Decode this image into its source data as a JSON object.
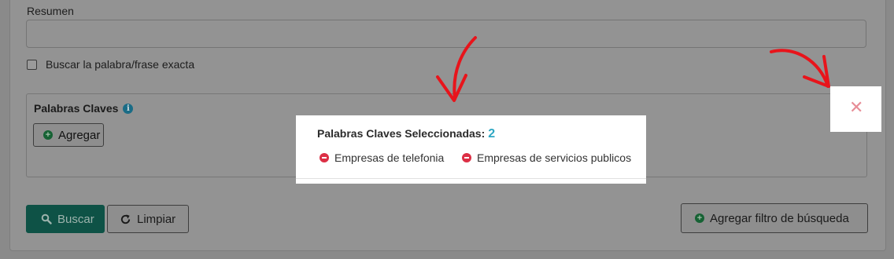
{
  "form": {
    "resumen_label": "Resumen",
    "resumen_value": "",
    "exact_label": "Buscar la palabra/frase exacta",
    "keywords_title": "Palabras Claves",
    "add_label": "Agregar",
    "search_label": "Buscar",
    "clear_label": "Limpiar",
    "add_filter_label": "Agregar filtro de búsqueda"
  },
  "popup": {
    "title": "Palabras Claves Seleccionadas:",
    "count": "2",
    "items": [
      {
        "label": "Empresas de telefonia"
      },
      {
        "label": "Empresas de servicios publicos"
      }
    ]
  },
  "close": {
    "symbol": "✕"
  },
  "icons": {
    "info": "info-icon",
    "plus": "plus-circle-icon",
    "minus": "minus-circle-icon",
    "search": "search-icon",
    "refresh": "refresh-icon",
    "close": "close-icon"
  },
  "colors": {
    "primary": "#0e5246",
    "count": "#2ea7c3",
    "remove": "#dc2f45",
    "annotation": "#e8141b"
  }
}
